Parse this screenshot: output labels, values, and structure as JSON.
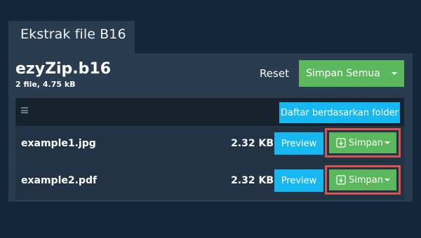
{
  "tab": {
    "title": "Ekstrak file B16"
  },
  "archive": {
    "name": "ezyZip.b16",
    "meta": "2 file, 4.75 kB"
  },
  "actions": {
    "reset_label": "Reset",
    "save_all_label": "Simpan Semua"
  },
  "toolbar": {
    "menu_icon": "hamburger-menu-icon",
    "folder_button_label": "Daftar berdasarkan folder"
  },
  "files": [
    {
      "name": "example1.jpg",
      "size": "2.32 KB",
      "preview_label": "Preview",
      "save_label": "Simpan"
    },
    {
      "name": "example2.pdf",
      "size": "2.32 KB",
      "preview_label": "Preview",
      "save_label": "Simpan"
    }
  ],
  "colors": {
    "background": "#14263a",
    "panel": "#2a3c50",
    "green": "#5cb85c",
    "blue": "#16b8f2",
    "highlight": "#d9534f"
  }
}
